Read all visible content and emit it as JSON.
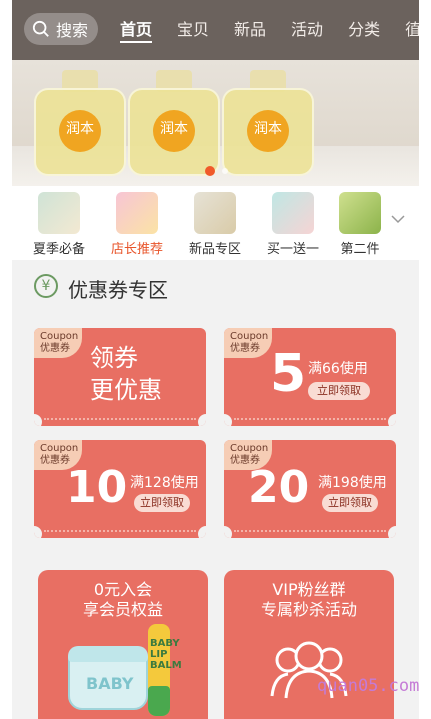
{
  "header": {
    "search_label": "搜索",
    "tabs": [
      {
        "label": "首页",
        "active": true
      },
      {
        "label": "宝贝",
        "active": false
      },
      {
        "label": "新品",
        "active": false
      },
      {
        "label": "活动",
        "active": false
      },
      {
        "label": "分类",
        "active": false
      },
      {
        "label": "徝",
        "active": false
      }
    ]
  },
  "banner": {
    "product_label": "润本",
    "dots": 2,
    "active_dot": 0
  },
  "categories": [
    {
      "label": "夏季必备",
      "highlight": false
    },
    {
      "label": "店长推荐",
      "highlight": true
    },
    {
      "label": "新品专区",
      "highlight": false
    },
    {
      "label": "买一送一",
      "highlight": false
    },
    {
      "label": "第二件",
      "highlight": false
    }
  ],
  "coupon_section": {
    "title": "优惠券专区",
    "icon": "yen-icon"
  },
  "coupons": {
    "lead": {
      "tag_line1": "Coupon",
      "tag_line2": "优惠券",
      "line1": "领券",
      "line2": "更优惠"
    },
    "items": [
      {
        "tag_line1": "Coupon",
        "tag_line2": "优惠券",
        "amount": "5",
        "condition": "满66使用",
        "button": "立即领取"
      },
      {
        "tag_line1": "Coupon",
        "tag_line2": "优惠券",
        "amount": "10",
        "condition": "满128使用",
        "button": "立即领取"
      },
      {
        "tag_line1": "Coupon",
        "tag_line2": "优惠券",
        "amount": "20",
        "condition": "满198使用",
        "button": "立即领取"
      }
    ]
  },
  "promo_cards": [
    {
      "line1": "0元入会",
      "line2": "享会员权益",
      "jar_text": "BABY",
      "stick_text": "BABY LIP BALM"
    },
    {
      "line1": "VIP粉丝群",
      "line2": "专属秒杀活动",
      "icon": "group-people-icon"
    }
  ],
  "watermark": "quan05.com",
  "colors": {
    "accent": "#e86f63",
    "header_bg": "#6b625d",
    "highlight_text": "#e8542a",
    "page_bg": "#f2f2f2"
  }
}
